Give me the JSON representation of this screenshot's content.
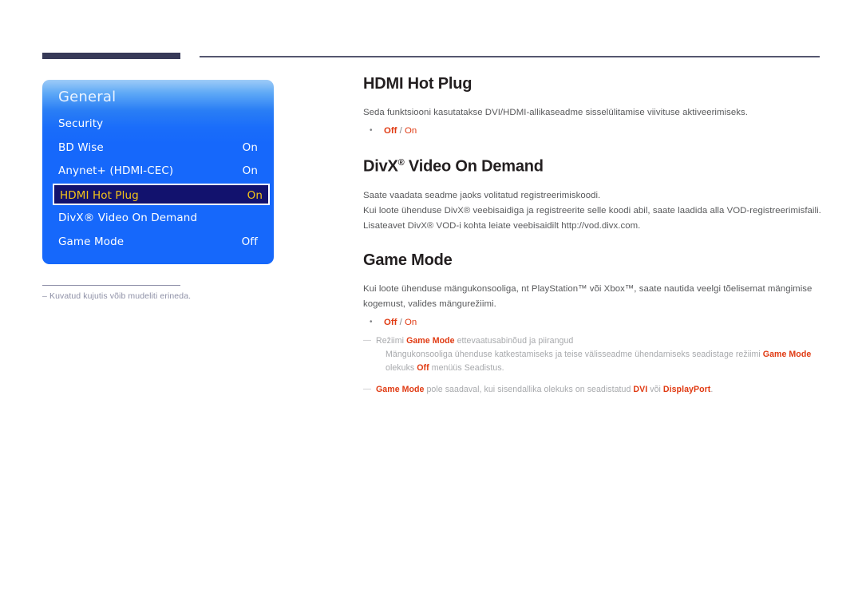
{
  "header": {
    "left_bar": "",
    "right_rule": ""
  },
  "osd": {
    "title": "General",
    "rows": [
      {
        "label": "Security",
        "value": "",
        "selected": false
      },
      {
        "label": "BD Wise",
        "value": "On",
        "selected": false
      },
      {
        "label": "Anynet+ (HDMI-CEC)",
        "value": "On",
        "selected": false
      },
      {
        "label": "HDMI Hot Plug",
        "value": "On",
        "selected": true
      },
      {
        "label": "DivX® Video On Demand",
        "value": "",
        "selected": false
      },
      {
        "label": "Game Mode",
        "value": "Off",
        "selected": false
      }
    ],
    "footnote": "Kuvatud kujutis võib mudeliti erineda.",
    "footnote_dash": "–",
    "colors": {
      "panel_blue": "#1668fb",
      "panel_blue_light": "#9ecbf7",
      "selected_bg": "#12126e",
      "selected_text": "#f5c518",
      "bar_navy": "#373a58"
    }
  },
  "document": {
    "sections": [
      {
        "heading": "HDMI Hot Plug",
        "heading_reg": "",
        "paragraphs": [
          "Seda funktsiooni kasutatakse DVI/HDMI-allikaseadme sisselülitamise viivituse aktiveerimiseks."
        ],
        "options": {
          "first": "Off",
          "separator": " / ",
          "second": "On"
        },
        "notes": []
      },
      {
        "heading": "DivX",
        "heading_reg": "®",
        "heading_rest": " Video On Demand",
        "paragraphs": [
          "Saate vaadata seadme jaoks volitatud registreerimiskoodi.",
          "Kui loote ühenduse DivX® veebisaidiga ja registreerite selle koodi abil, saate laadida alla VOD-registreerimisfaili.",
          "Lisateavet DivX® VOD-i kohta leiate veebisaidilt http://vod.divx.com."
        ],
        "options": null,
        "notes": []
      },
      {
        "heading": "Game Mode",
        "heading_reg": "",
        "paragraphs": [
          "Kui loote ühenduse mängukonsooliga, nt PlayStation™ või Xbox™, saate nautida veelgi tõelisemat mängimise kogemust, valides mängurežiimi."
        ],
        "options": {
          "first": "Off",
          "separator": " / ",
          "second": "On"
        },
        "notes": [
          {
            "lead": "Režiimi ",
            "hl": "Game Mode",
            "tail": " ettevaatusabinõud ja piirangud",
            "sub": {
              "part1": "Mängukonsooliga ühenduse katkestamiseks ja teise välisseadme ühendamiseks seadistage režiimi ",
              "hl1": "Game Mode",
              "part2": " olekuks ",
              "hl2": "Off",
              "part3": " menüüs Seadistus."
            }
          },
          {
            "hl_first": "Game Mode",
            "lead": " pole saadaval, kui sisendallika olekuks on seadistatud ",
            "hl1": "DVI",
            "mid": " või ",
            "hl2": "DisplayPort",
            "tail": "."
          }
        ]
      }
    ]
  },
  "colors": {
    "accent_red": "#e03a12",
    "body_gray": "#58595b",
    "note_gray": "#a7a9ac",
    "heading_black": "#231f20"
  }
}
